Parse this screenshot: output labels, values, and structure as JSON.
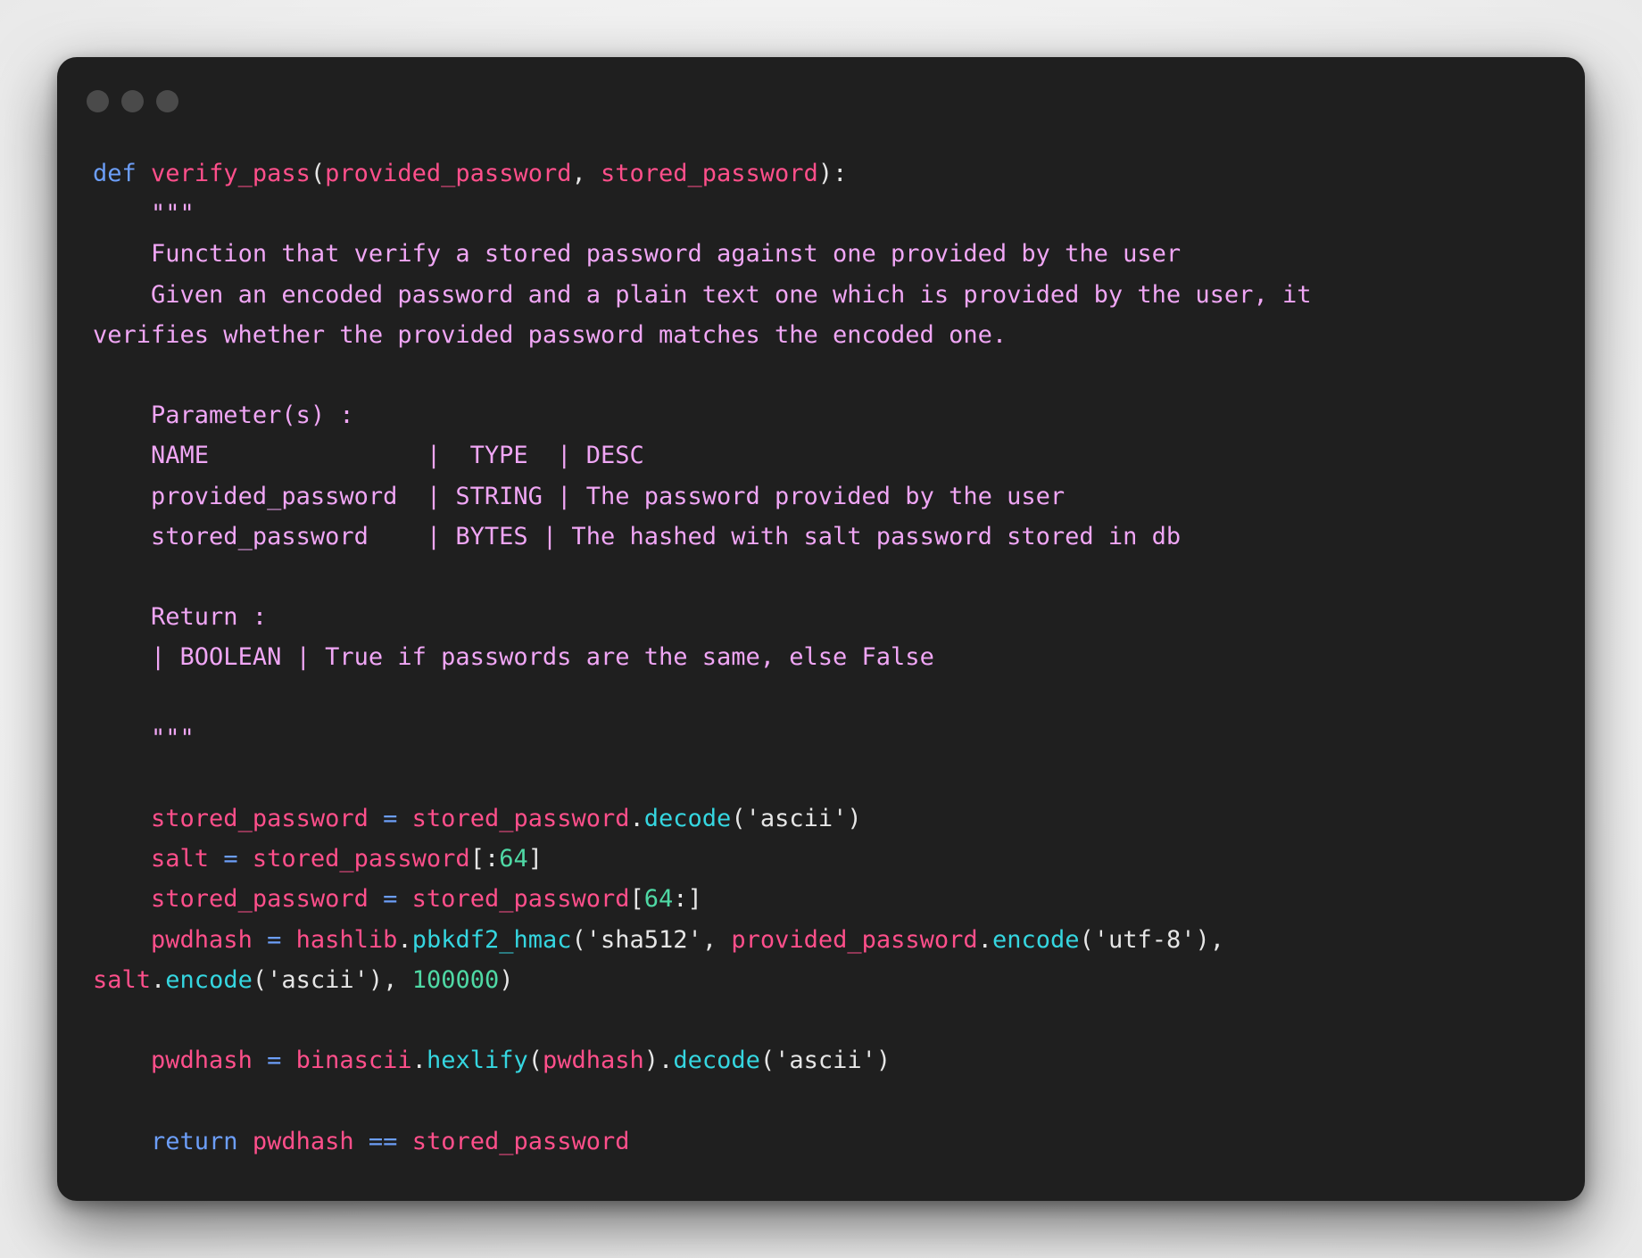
{
  "window": {
    "controls": [
      "close",
      "minimize",
      "maximize"
    ]
  },
  "code": {
    "language": "python",
    "lines": [
      "def verify_pass(provided_password, stored_password):",
      "    \"\"\"",
      "    Function that verify a stored password against one provided by the user",
      "    Given an encoded password and a plain text one which is provided by the user, it",
      "verifies whether the provided password matches the encoded one.",
      "",
      "    Parameter(s) :",
      "    NAME               |  TYPE  | DESC",
      "    provided_password  | STRING | The password provided by the user",
      "    stored_password    | BYTES | The hashed with salt password stored in db",
      "",
      "    Return :",
      "    | BOOLEAN | True if passwords are the same, else False",
      "",
      "    \"\"\"",
      "",
      "    stored_password = stored_password.decode('ascii')",
      "    salt = stored_password[:64]",
      "    stored_password = stored_password[64:]",
      "    pwdhash = hashlib.pbkdf2_hmac('sha512', provided_password.encode('utf-8'),",
      "salt.encode('ascii'), 100000)",
      "",
      "    pwdhash = binascii.hexlify(pwdhash).decode('ascii')",
      "",
      "    return pwdhash == stored_password"
    ],
    "tokens": {
      "def": "def",
      "fn_name": "verify_pass",
      "param1": "provided_password",
      "param2": "stored_password",
      "doc_quote": "\"\"\"",
      "doc1": "Function that verify a stored password against one provided by the user",
      "doc2": "Given an encoded password and a plain text one which is provided by the user, it",
      "doc3": "verifies whether the provided password matches the encoded one.",
      "doc_params": "Parameter(s) :",
      "doc_header": "NAME               |  TYPE  | DESC",
      "doc_row1": "provided_password  | STRING | The password provided by the user",
      "doc_row2": "stored_password    | BYTES | The hashed with salt password stored in db",
      "doc_return": "Return :",
      "doc_return_row": "| BOOLEAN | True if passwords are the same, else False",
      "stored_password": "stored_password",
      "salt": "salt",
      "pwdhash": "pwdhash",
      "provided_password": "provided_password",
      "decode": "decode",
      "encode": "encode",
      "hashlib": "hashlib",
      "pbkdf2_hmac": "pbkdf2_hmac",
      "binascii": "binascii",
      "hexlify": "hexlify",
      "ascii": "'ascii'",
      "sha512": "'sha512'",
      "utf8": "'utf-8'",
      "n64": "64",
      "n100000": "100000",
      "return": "return",
      "eq": "==",
      "assign": "="
    }
  },
  "colors": {
    "window_bg": "#1f1f1f",
    "keyword": "#6c9ef8",
    "identifier": "#ff4f8b",
    "method": "#35d6e0",
    "number": "#4fd9a5",
    "docstring": "#f0a6f5",
    "text": "#e6e6e6"
  }
}
